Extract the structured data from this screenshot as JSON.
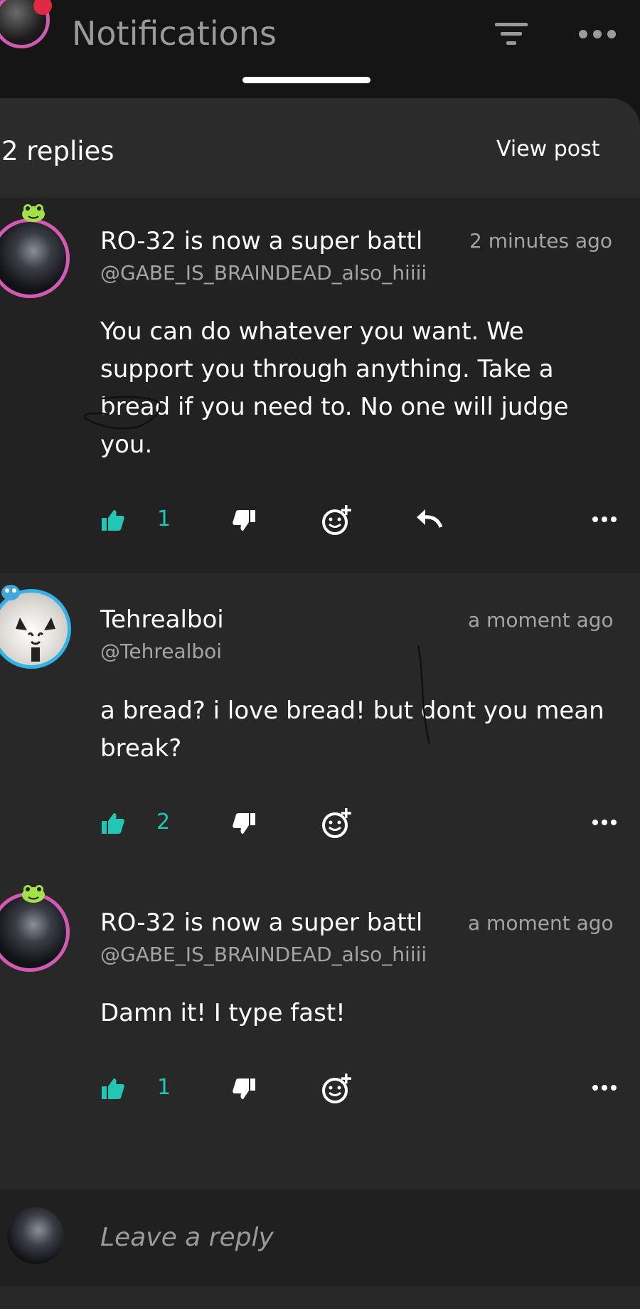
{
  "header": {
    "title": "Notifications",
    "replies_count": "2 replies",
    "view_post_label": "View post"
  },
  "comments": [
    {
      "name": "RO-32 is now a super battl",
      "handle": "@GABE_IS_BRAINDEAD_also_hiiii",
      "time": "2 minutes ago",
      "body": "You can do whatever you want. We support you through anything. Take a bread if you need to. No one will judge you.",
      "likes": "1"
    },
    {
      "name": "Tehrealboi",
      "handle": "@Tehrealboi",
      "time": "a moment ago",
      "body": "a bread? i love bread! but dont you mean break?",
      "likes": "2"
    },
    {
      "name": "RO-32 is now a super battl",
      "handle": "@GABE_IS_BRAINDEAD_also_hiiii",
      "time": "a moment ago",
      "body": "Damn it! I type fast!",
      "likes": "1"
    }
  ],
  "composer": {
    "placeholder": "Leave a reply"
  },
  "icons": {
    "like": "thumbs-up-icon",
    "dislike": "thumbs-down-icon",
    "react": "emoji-add-icon",
    "reply": "reply-arrow-icon",
    "more": "more-dots-icon",
    "filter": "filter-icon"
  },
  "colors": {
    "accent": "#21c7b4",
    "background": "#151515",
    "panel": "#282828",
    "robot_avatar_ring": "#d35ab3",
    "cat_avatar_ring": "#33b4e8"
  }
}
